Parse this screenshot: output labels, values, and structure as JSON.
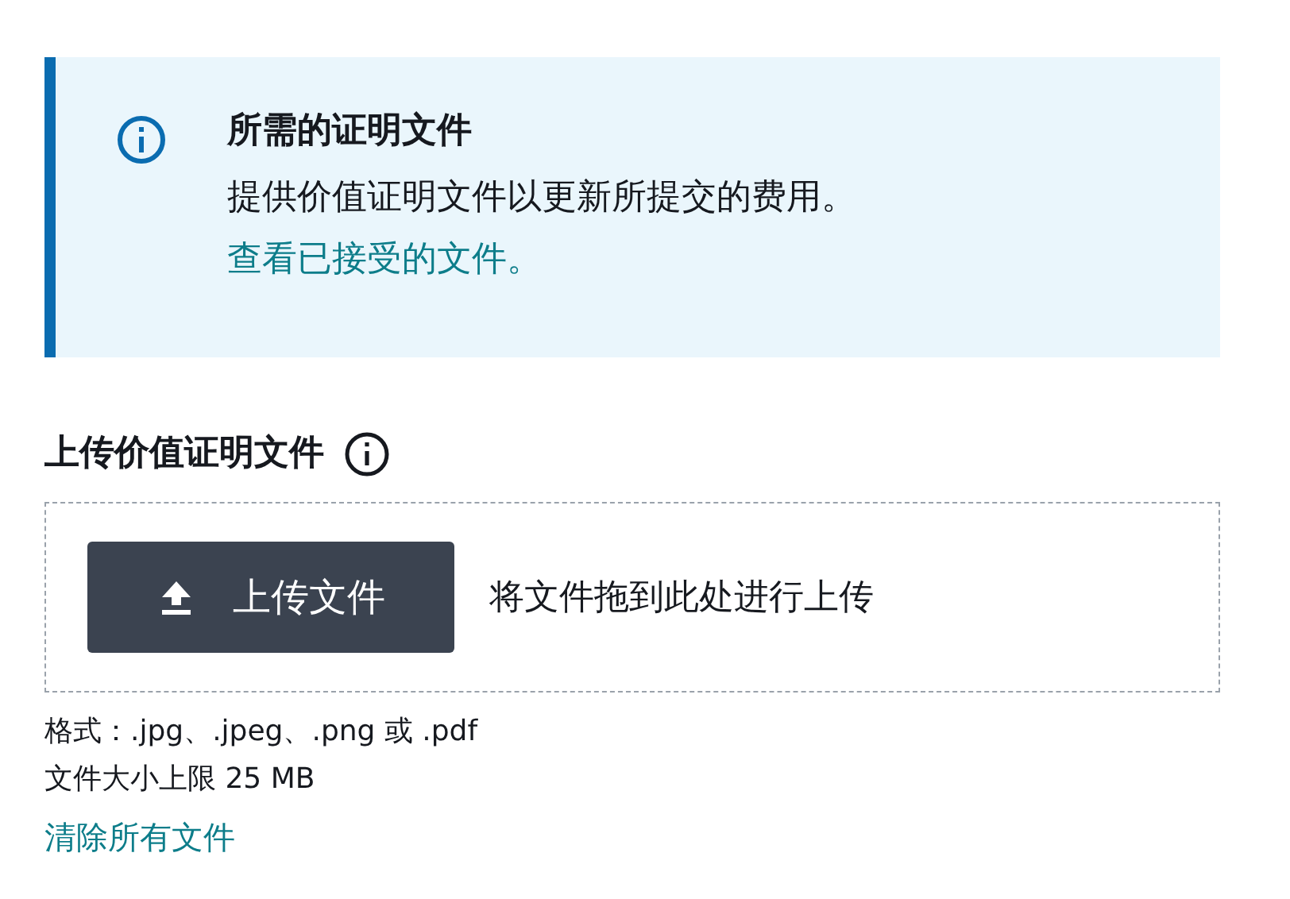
{
  "alert": {
    "title": "所需的证明文件",
    "message": "提供价值证明文件以更新所提交的费用。",
    "link": "查看已接受的文件。"
  },
  "upload": {
    "label": "上传价值证明文件",
    "button": "上传文件",
    "drop_hint": "将文件拖到此处进行上传",
    "constraints": [
      "格式：.jpg、.jpeg、.png 或 .pdf",
      "文件大小上限 25 MB"
    ],
    "clear_link": "清除所有文件"
  }
}
